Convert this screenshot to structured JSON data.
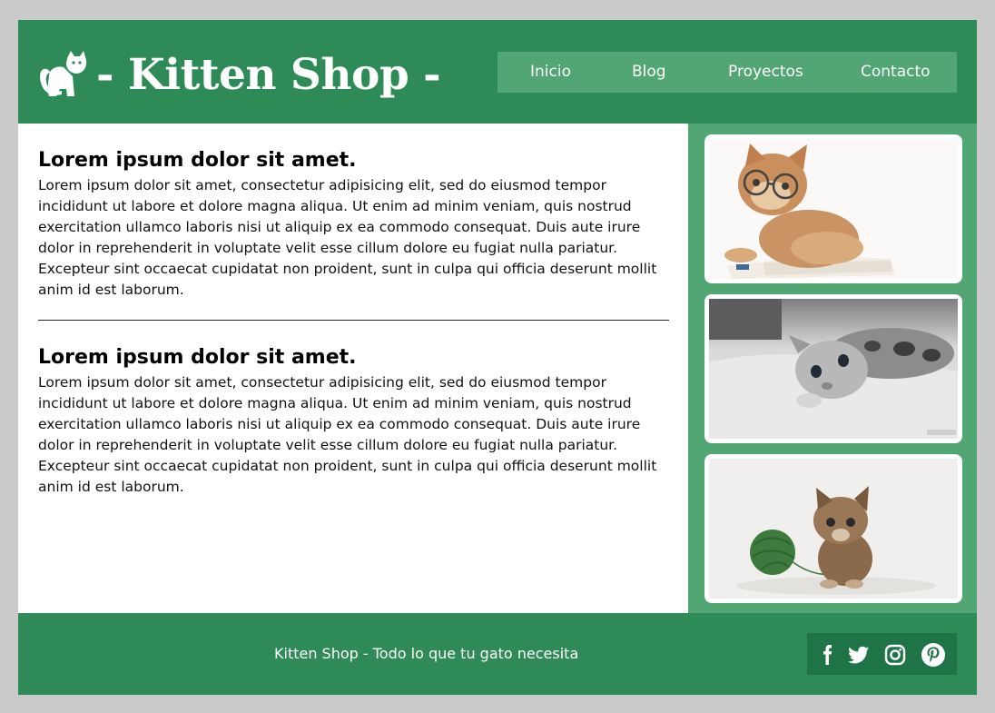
{
  "header": {
    "logo_icon": "cat-icon",
    "title": "- Kitten Shop -",
    "nav": [
      "Inicio",
      "Blog",
      "Proyectos",
      "Contacto"
    ]
  },
  "main": {
    "articles": [
      {
        "heading": "Lorem ipsum dolor sit amet.",
        "body": "Lorem ipsum dolor sit amet, consectetur adipisicing elit, sed do eiusmod tempor incididunt ut labore et dolore magna aliqua. Ut enim ad minim veniam, quis nostrud exercitation ullamco laboris nisi ut aliquip ex ea commodo consequat. Duis aute irure dolor in reprehenderit in voluptate velit esse cillum dolore eu fugiat nulla pariatur. Excepteur sint occaecat cupidatat non proident, sunt in culpa qui officia deserunt mollit anim id est laborum."
      },
      {
        "heading": "Lorem ipsum dolor sit amet.",
        "body": "Lorem ipsum dolor sit amet, consectetur adipisicing elit, sed do eiusmod tempor incididunt ut labore et dolore magna aliqua. Ut enim ad minim veniam, quis nostrud exercitation ullamco laboris nisi ut aliquip ex ea commodo consequat. Duis aute irure dolor in reprehenderit in voluptate velit esse cillum dolore eu fugiat nulla pariatur. Excepteur sint occaecat cupidatat non proident, sunt in culpa qui officia deserunt mollit anim id est laborum."
      }
    ]
  },
  "sidebar": {
    "photos": [
      "kitten-with-glasses-reading",
      "kitten-lying-on-bed-grayscale",
      "kitten-with-green-yarn-ball"
    ]
  },
  "footer": {
    "text": "Kitten Shop - Todo lo que tu gato necesita",
    "social_icons": [
      "facebook-icon",
      "twitter-icon",
      "instagram-icon",
      "pinterest-icon"
    ]
  },
  "colors": {
    "background": "#cacaca",
    "primary_green": "#2e8b57",
    "light_green": "#52a673",
    "dark_green": "#1e7446",
    "white": "#ffffff"
  }
}
